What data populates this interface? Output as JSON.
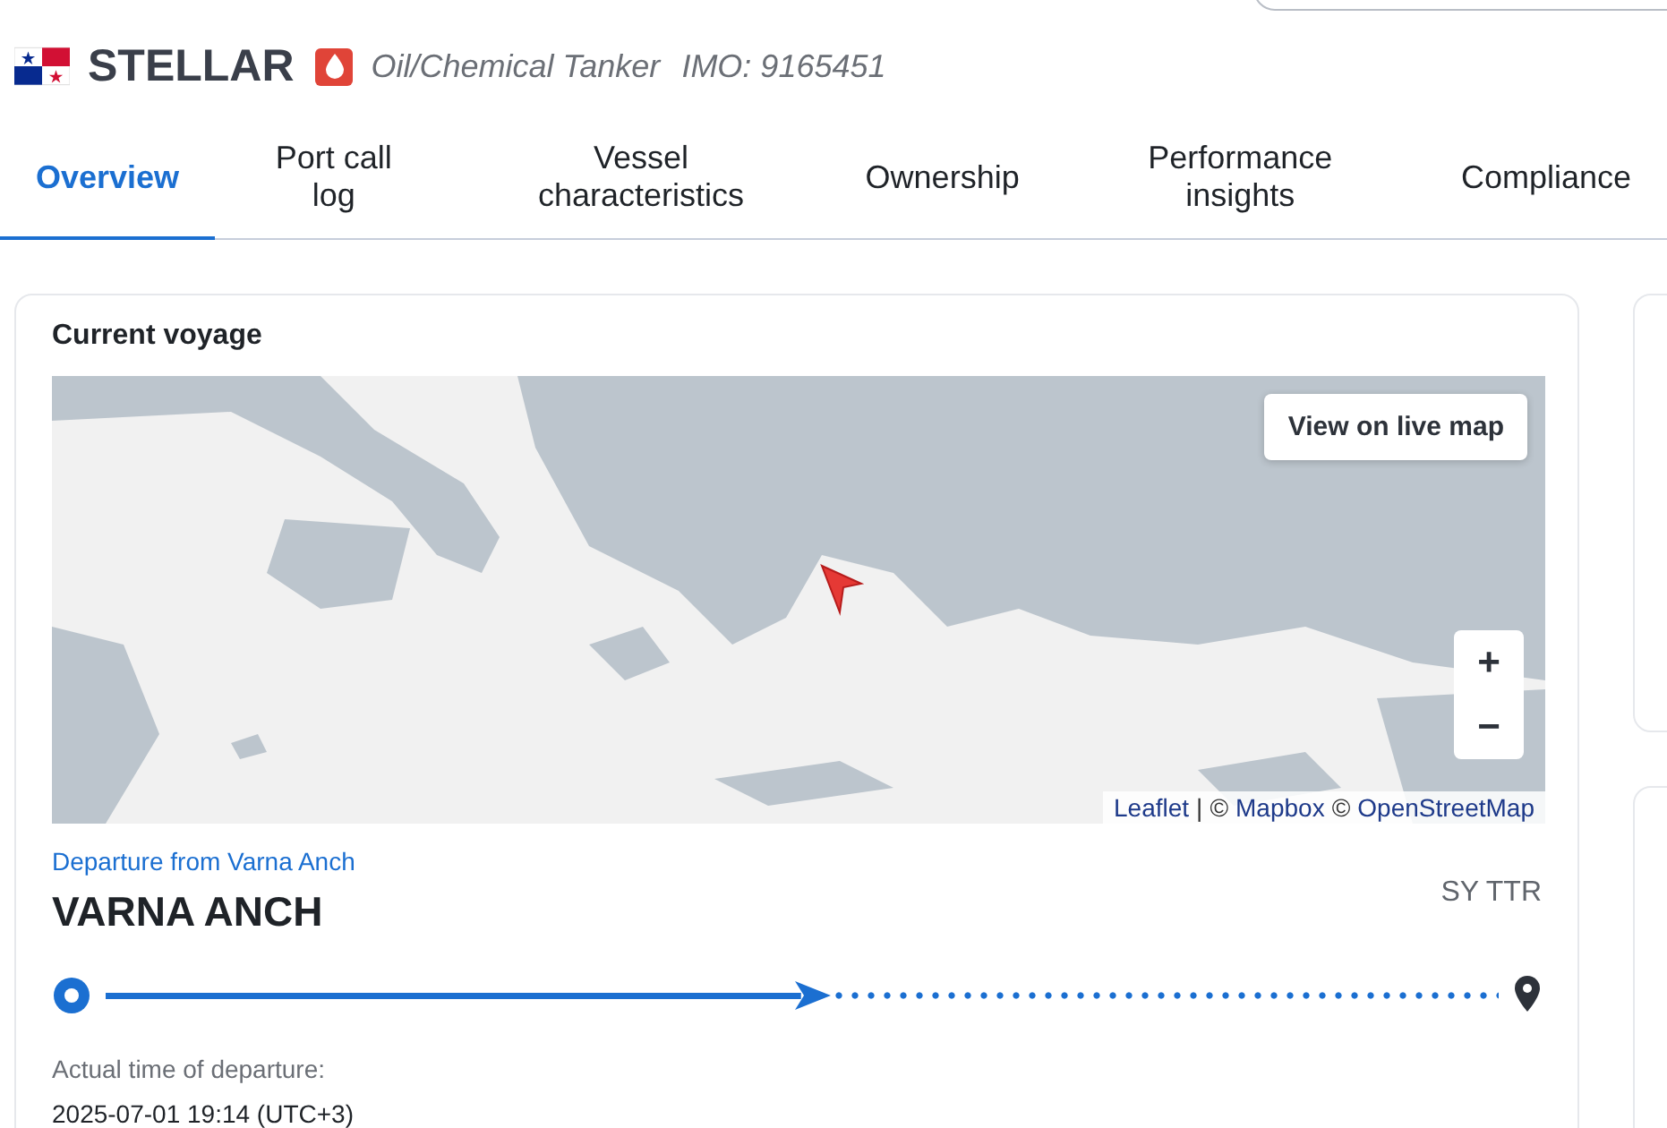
{
  "vessel": {
    "name": "STELLAR",
    "type": "Oil/Chemical Tanker",
    "imo": "IMO: 9165451"
  },
  "tabs": [
    {
      "label": "Overview",
      "selected": true
    },
    {
      "label": "Port call log",
      "selected": false
    },
    {
      "label": "Vessel characteristics",
      "selected": false
    },
    {
      "label": "Ownership",
      "selected": false
    },
    {
      "label": "Performance insights",
      "selected": false
    },
    {
      "label": "Compliance",
      "selected": false
    }
  ],
  "current_voyage": {
    "title": "Current voyage",
    "map": {
      "kind": "picture",
      "live_map_button": "View on live map",
      "zoom_in": "+",
      "zoom_out": "−",
      "attribution": [
        {
          "text": "Leaflet",
          "kind": "link"
        },
        {
          "text": "|",
          "kind": "text"
        },
        {
          "text": "©",
          "kind": "text"
        },
        {
          "text": "Mapbox",
          "kind": "link"
        },
        {
          "text": "©",
          "kind": "text"
        },
        {
          "text": "OpenStreetMap",
          "kind": "link"
        }
      ]
    },
    "departure_label": "Departure from Varna Anch",
    "origin": "VARNA ANCH",
    "destination": "SY TTR",
    "level": 0.52,
    "time_label": "Actual time of departure:",
    "time": "2025-07-01 19:14 (UTC+3)"
  }
}
